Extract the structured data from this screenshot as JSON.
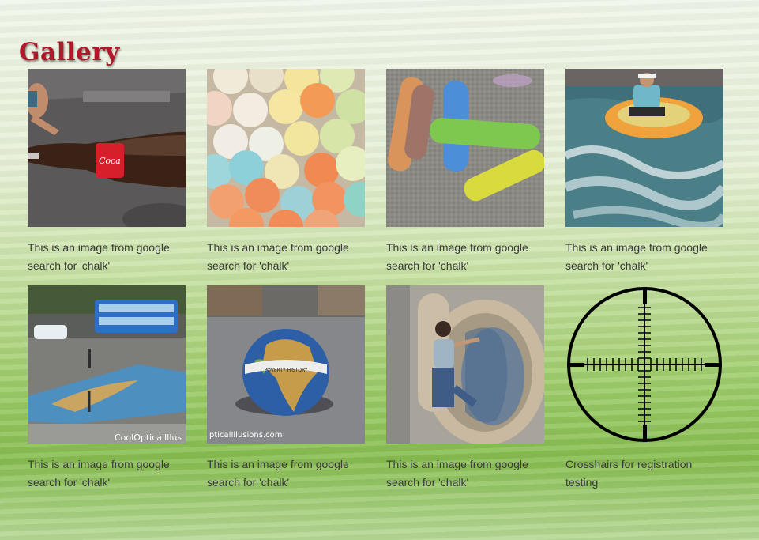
{
  "page": {
    "title": "Gallery"
  },
  "gallery": {
    "items": [
      {
        "line1": "This is an image from google",
        "line2": "search for 'chalk'",
        "image": "coca-cola-bottle-chalk-art",
        "watermark": ""
      },
      {
        "line1": "This is an image from google",
        "line2": "search for 'chalk'",
        "image": "colored-chalk-sticks-ends",
        "watermark": ""
      },
      {
        "line1": "This is an image from google",
        "line2": "search for 'chalk'",
        "image": "chalk-sticks-on-pavement",
        "watermark": ""
      },
      {
        "line1": "This is an image from google",
        "line2": "search for 'chalk'",
        "image": "rafting-3d-chalk-art",
        "watermark": ""
      },
      {
        "line1": "This is an image from google",
        "line2": "search for 'chalk'",
        "image": "street-chalk-art-with-bus",
        "watermark": "CoolOpticalIllus"
      },
      {
        "line1": "This is an image from google",
        "line2": "search for 'chalk'",
        "image": "globe-3d-chalk-art",
        "watermark": "pticalIllusions.com"
      },
      {
        "line1": "This is an image from google",
        "line2": "search for 'chalk'",
        "image": "vault-door-3d-chalk-art",
        "watermark": ""
      },
      {
        "line1": "Crosshairs for registration",
        "line2": "testing",
        "image": "crosshairs",
        "watermark": ""
      }
    ]
  },
  "colors": {
    "title": "#b1182a",
    "caption": "#3a3a3a"
  }
}
